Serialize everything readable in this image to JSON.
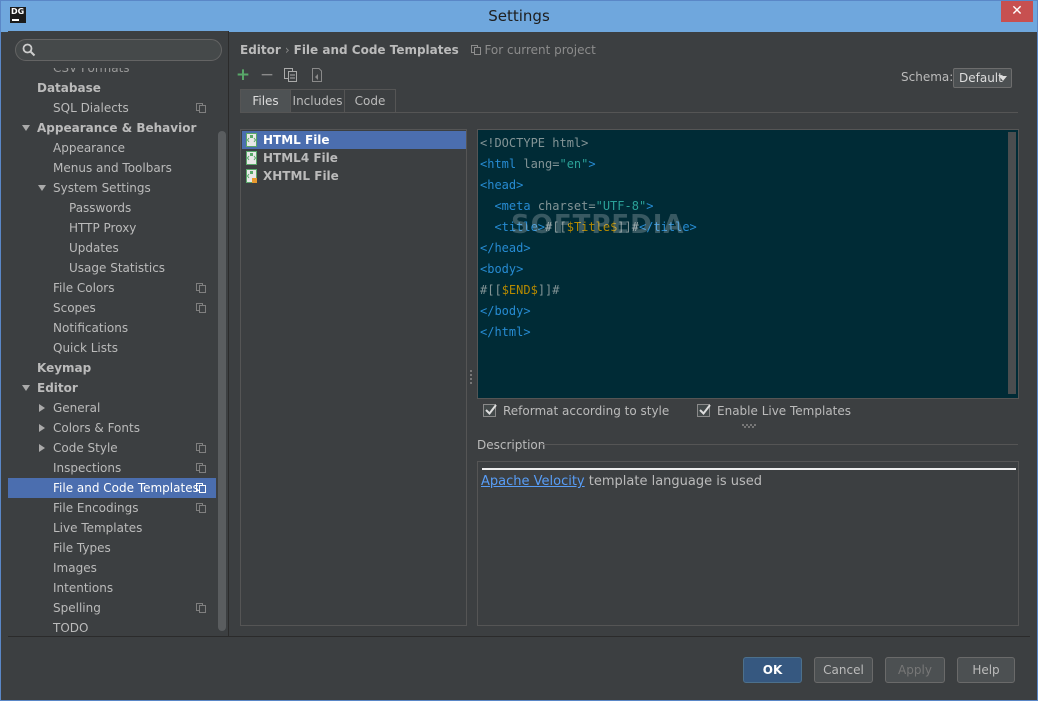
{
  "window": {
    "title": "Settings",
    "app_icon_text": "DG",
    "close_glyph": "✕"
  },
  "search": {
    "placeholder": ""
  },
  "sidebar": {
    "clipped_item": "CSV Formats",
    "items": [
      {
        "label": "Database",
        "level": 0,
        "bold": true,
        "arrow": "",
        "project": false
      },
      {
        "label": "SQL Dialects",
        "level": 1,
        "bold": false,
        "arrow": "",
        "project": true
      },
      {
        "label": "Appearance & Behavior",
        "level": 0,
        "bold": true,
        "arrow": "down",
        "project": false
      },
      {
        "label": "Appearance",
        "level": 1,
        "bold": false,
        "arrow": "",
        "project": false
      },
      {
        "label": "Menus and Toolbars",
        "level": 1,
        "bold": false,
        "arrow": "",
        "project": false
      },
      {
        "label": "System Settings",
        "level": 1,
        "bold": false,
        "arrow": "down",
        "project": false
      },
      {
        "label": "Passwords",
        "level": 2,
        "bold": false,
        "arrow": "",
        "project": false
      },
      {
        "label": "HTTP Proxy",
        "level": 2,
        "bold": false,
        "arrow": "",
        "project": false
      },
      {
        "label": "Updates",
        "level": 2,
        "bold": false,
        "arrow": "",
        "project": false
      },
      {
        "label": "Usage Statistics",
        "level": 2,
        "bold": false,
        "arrow": "",
        "project": false
      },
      {
        "label": "File Colors",
        "level": 1,
        "bold": false,
        "arrow": "",
        "project": true
      },
      {
        "label": "Scopes",
        "level": 1,
        "bold": false,
        "arrow": "",
        "project": true
      },
      {
        "label": "Notifications",
        "level": 1,
        "bold": false,
        "arrow": "",
        "project": false
      },
      {
        "label": "Quick Lists",
        "level": 1,
        "bold": false,
        "arrow": "",
        "project": false
      },
      {
        "label": "Keymap",
        "level": 0,
        "bold": true,
        "arrow": "",
        "project": false
      },
      {
        "label": "Editor",
        "level": 0,
        "bold": true,
        "arrow": "down",
        "project": false
      },
      {
        "label": "General",
        "level": 1,
        "bold": false,
        "arrow": "right",
        "project": false
      },
      {
        "label": "Colors & Fonts",
        "level": 1,
        "bold": false,
        "arrow": "right",
        "project": false
      },
      {
        "label": "Code Style",
        "level": 1,
        "bold": false,
        "arrow": "right",
        "project": true
      },
      {
        "label": "Inspections",
        "level": 1,
        "bold": false,
        "arrow": "",
        "project": true
      },
      {
        "label": "File and Code Templates",
        "level": 1,
        "bold": false,
        "arrow": "",
        "project": true,
        "selected": true
      },
      {
        "label": "File Encodings",
        "level": 1,
        "bold": false,
        "arrow": "",
        "project": true
      },
      {
        "label": "Live Templates",
        "level": 1,
        "bold": false,
        "arrow": "",
        "project": false
      },
      {
        "label": "File Types",
        "level": 1,
        "bold": false,
        "arrow": "",
        "project": false
      },
      {
        "label": "Images",
        "level": 1,
        "bold": false,
        "arrow": "",
        "project": false
      },
      {
        "label": "Intentions",
        "level": 1,
        "bold": false,
        "arrow": "",
        "project": false
      },
      {
        "label": "Spelling",
        "level": 1,
        "bold": false,
        "arrow": "",
        "project": true
      },
      {
        "label": "TODO",
        "level": 1,
        "bold": false,
        "arrow": "",
        "project": false
      }
    ]
  },
  "breadcrumb": {
    "part1": "Editor",
    "separator": "›",
    "part2": "File and Code Templates",
    "scope": "For current project"
  },
  "toolbar": {
    "add": "+",
    "remove": "−"
  },
  "schema": {
    "label": "Schema:",
    "value": "Default"
  },
  "tabs": [
    "Files",
    "Includes",
    "Code"
  ],
  "files": [
    {
      "label": "HTML File",
      "selected": true,
      "badge": false
    },
    {
      "label": "HTML4 File",
      "selected": false,
      "badge": false
    },
    {
      "label": "XHTML File",
      "selected": false,
      "badge": true
    }
  ],
  "code_lines": [
    [
      [
        "punct",
        "<!DOCTYPE html>"
      ]
    ],
    [
      [
        "tag",
        "<html "
      ],
      [
        "attr",
        "lang="
      ],
      [
        "str",
        "\"en\""
      ],
      [
        "tag",
        ">"
      ]
    ],
    [
      [
        "tag",
        "<head>"
      ]
    ],
    [
      [
        "punct",
        "  "
      ],
      [
        "tag",
        "<meta "
      ],
      [
        "attr",
        "charset="
      ],
      [
        "str",
        "\"UTF-8\""
      ],
      [
        "tag",
        ">"
      ]
    ],
    [
      [
        "punct",
        "  "
      ],
      [
        "tag",
        "<title>"
      ],
      [
        "punct",
        "#[["
      ],
      [
        "var",
        "$Title$"
      ],
      [
        "punct",
        "]]#"
      ],
      [
        "tag",
        "</title>"
      ]
    ],
    [
      [
        "tag",
        "</head>"
      ]
    ],
    [
      [
        "tag",
        "<body>"
      ]
    ],
    [
      [
        "punct",
        "#[["
      ],
      [
        "var",
        "$END$"
      ],
      [
        "punct",
        "]]#"
      ]
    ],
    [
      [
        "tag",
        "</body>"
      ]
    ],
    [
      [
        "tag",
        "</html>"
      ]
    ]
  ],
  "watermark": "SOFTPEDIA",
  "options": {
    "reformat": {
      "label": "Reformat according to style",
      "checked": true
    },
    "live_templates": {
      "label": "Enable Live Templates",
      "checked": true
    }
  },
  "description": {
    "label": "Description",
    "link": "Apache Velocity",
    "text": " template language is used"
  },
  "buttons": {
    "ok": "OK",
    "cancel": "Cancel",
    "apply": "Apply",
    "help": "Help"
  },
  "colors": {
    "selection": "#4b6eaf",
    "editor_bg": "#002b36",
    "tag": "#268bd2",
    "string": "#2aa198",
    "variable": "#b58900",
    "link": "#589df6",
    "add_icon": "#59a869"
  }
}
